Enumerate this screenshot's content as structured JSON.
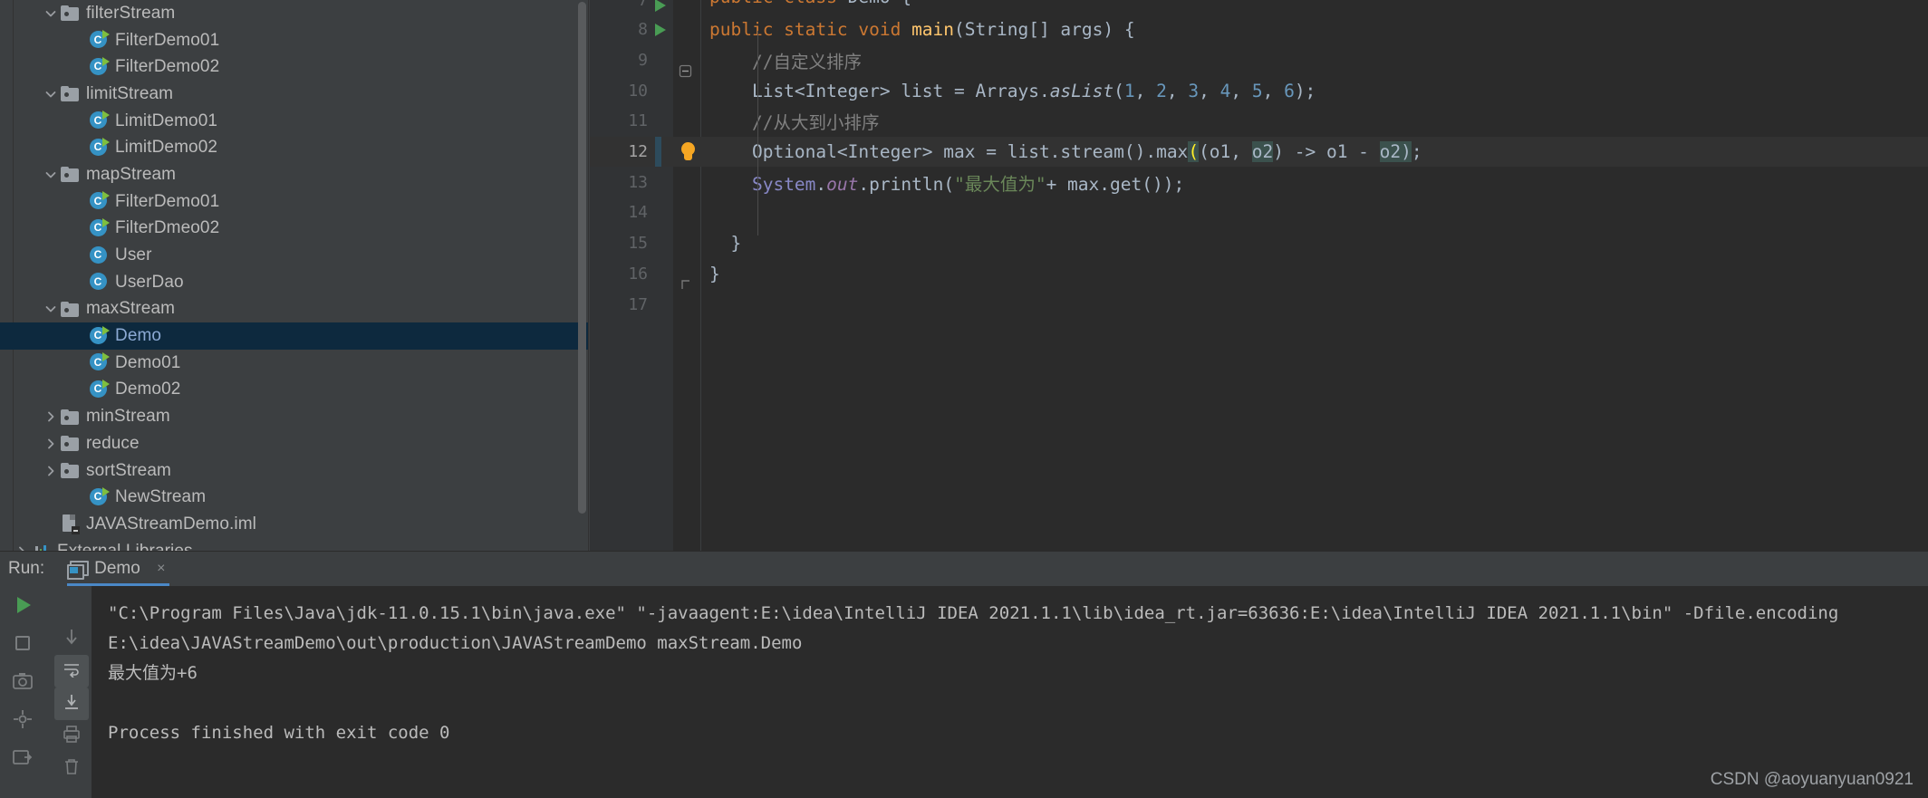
{
  "project_tree": {
    "items": [
      {
        "label": "filterStream",
        "type": "folder",
        "depth": 2,
        "arrow": "down",
        "selected": false
      },
      {
        "label": "FilterDemo01",
        "type": "class-runnable",
        "depth": 3,
        "arrow": "none",
        "selected": false
      },
      {
        "label": "FilterDemo02",
        "type": "class-runnable",
        "depth": 3,
        "arrow": "none",
        "selected": false
      },
      {
        "label": "limitStream",
        "type": "folder",
        "depth": 2,
        "arrow": "down",
        "selected": false
      },
      {
        "label": "LimitDemo01",
        "type": "class-runnable",
        "depth": 3,
        "arrow": "none",
        "selected": false
      },
      {
        "label": "LimitDemo02",
        "type": "class-runnable",
        "depth": 3,
        "arrow": "none",
        "selected": false
      },
      {
        "label": "mapStream",
        "type": "folder",
        "depth": 2,
        "arrow": "down",
        "selected": false
      },
      {
        "label": "FilterDemo01",
        "type": "class-runnable",
        "depth": 3,
        "arrow": "none",
        "selected": false
      },
      {
        "label": "FilterDmeo02",
        "type": "class-runnable",
        "depth": 3,
        "arrow": "none",
        "selected": false
      },
      {
        "label": "User",
        "type": "class",
        "depth": 3,
        "arrow": "none",
        "selected": false
      },
      {
        "label": "UserDao",
        "type": "class",
        "depth": 3,
        "arrow": "none",
        "selected": false
      },
      {
        "label": "maxStream",
        "type": "folder",
        "depth": 2,
        "arrow": "down",
        "selected": false
      },
      {
        "label": "Demo",
        "type": "class-runnable",
        "depth": 3,
        "arrow": "none",
        "selected": true
      },
      {
        "label": "Demo01",
        "type": "class-runnable",
        "depth": 3,
        "arrow": "none",
        "selected": false
      },
      {
        "label": "Demo02",
        "type": "class-runnable",
        "depth": 3,
        "arrow": "none",
        "selected": false
      },
      {
        "label": "minStream",
        "type": "folder",
        "depth": 2,
        "arrow": "right",
        "selected": false
      },
      {
        "label": "reduce",
        "type": "folder",
        "depth": 2,
        "arrow": "right",
        "selected": false
      },
      {
        "label": "sortStream",
        "type": "folder",
        "depth": 2,
        "arrow": "right",
        "selected": false
      },
      {
        "label": "NewStream",
        "type": "class-runnable",
        "depth": 3,
        "arrow": "none",
        "selected": false
      },
      {
        "label": "JAVAStreamDemo.iml",
        "type": "iml",
        "depth": 2,
        "arrow": "none",
        "selected": false
      },
      {
        "label": "External Libraries",
        "type": "library",
        "depth": 1,
        "arrow": "right",
        "selected": false
      }
    ]
  },
  "editor": {
    "lines": [
      {
        "number": "7",
        "partial_top": true
      },
      {
        "number": "8"
      },
      {
        "number": "9"
      },
      {
        "number": "10"
      },
      {
        "number": "11"
      },
      {
        "number": "12"
      },
      {
        "number": "13"
      },
      {
        "number": "14"
      },
      {
        "number": "15"
      },
      {
        "number": "16"
      },
      {
        "number": "17"
      }
    ],
    "code": {
      "l7_text": "public class Demo {",
      "l8_kw1": "public",
      "l8_kw2": "static",
      "l8_kw3": "void",
      "l8_name": "main",
      "l8_rest": "(String[] args) {",
      "l9_comment": "//自定义排序",
      "l10_a": "List<Integer> list = Arrays.",
      "l10_b": "asList",
      "l10_c": "(",
      "l10_n1": "1",
      "l10_n2": "2",
      "l10_n3": "3",
      "l10_n4": "4",
      "l10_n5": "5",
      "l10_n6": "6",
      "l10_d": ");",
      "l11_comment": "//从大到小排序",
      "l12_a": "Optional<Integer> max = list.stream().max",
      "l12_paren": "(",
      "l12_b": "(o1, ",
      "l12_o2": "o2",
      "l12_c": ") -> o1 - ",
      "l12_o2b": "o2",
      "l12_d": ")",
      "l12_e": ";",
      "l13_sys": "System.",
      "l13_out": "out",
      "l13_p": ".println(",
      "l13_str": "\"最大值为\"",
      "l13_rest": "+ max.get());",
      "l15_brace": "}",
      "l16_brace": "}"
    }
  },
  "run_panel": {
    "run_label": "Run:",
    "tab_name": "Demo",
    "close_glyph": "×",
    "console": {
      "line1": "\"C:\\Program Files\\Java\\jdk-11.0.15.1\\bin\\java.exe\" \"-javaagent:E:\\idea\\IntelliJ IDEA 2021.1.1\\lib\\idea_rt.jar=63636:E:\\idea\\IntelliJ IDEA 2021.1.1\\bin\" -Dfile.encoding",
      "line2": "E:\\idea\\JAVAStreamDemo\\out\\production\\JAVAStreamDemo maxStream.Demo",
      "line3": "最大值为+6",
      "line4": "Process finished with exit code 0"
    },
    "toolbar": {
      "run_icon": "run-icon",
      "stop_icon": "stop-icon",
      "camera_icon": "camera-icon",
      "thread_icon": "thread-dump-icon",
      "rerun_icon": "rerun-icon",
      "down_icon": "scroll-down-icon",
      "wrap_icon": "soft-wrap-icon",
      "scroll_end_icon": "scroll-to-end-icon",
      "print_icon": "print-icon",
      "trash_icon": "clear-all-icon"
    }
  },
  "watermark": {
    "text": "CSDN @aoyuanyuan0921"
  },
  "colors": {
    "background": "#3c3f41",
    "editor_bg": "#2b2b2b",
    "gutter_bg": "#313335",
    "selection": "#0d293e",
    "accent": "#4a88c7",
    "keyword": "#cc7832",
    "string": "#6a8759",
    "number": "#6897bb",
    "comment": "#808080",
    "method": "#ffc66d",
    "static_field": "#9876aa",
    "text": "#a9b7c6",
    "run_green": "#499c54"
  }
}
